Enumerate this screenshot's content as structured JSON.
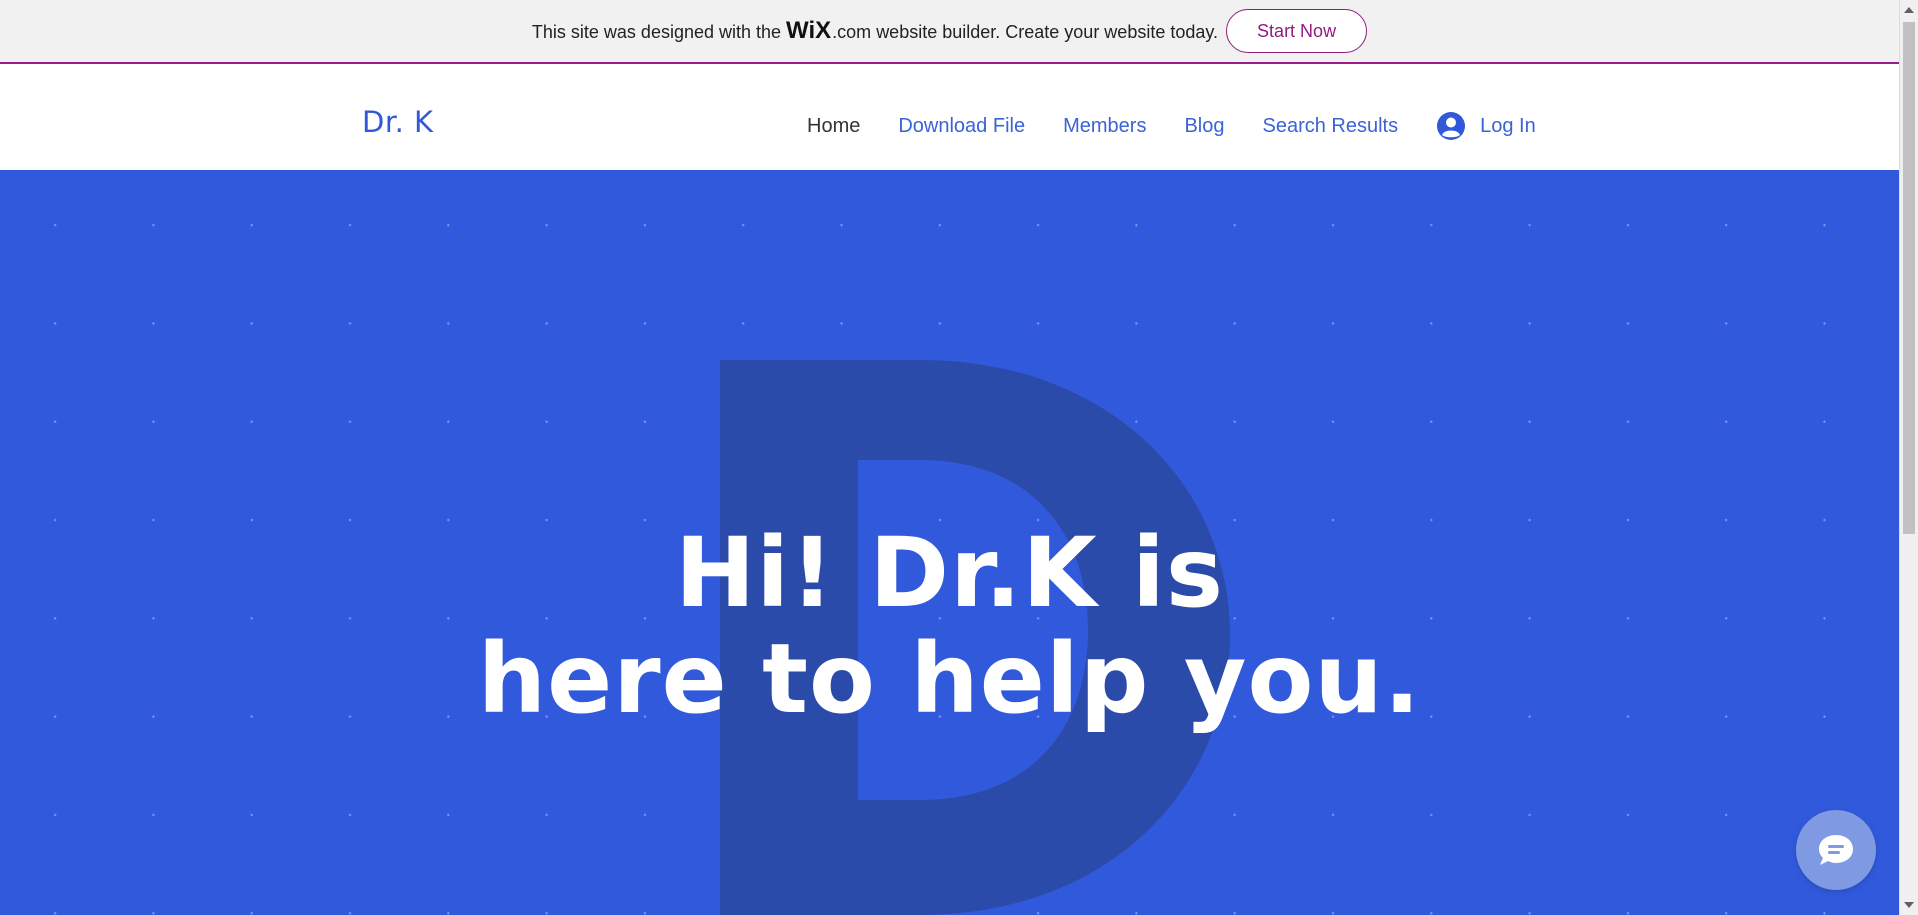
{
  "banner": {
    "text_before": "This site was designed with the",
    "wix_logo": "WiX",
    "dotcom": ".com",
    "text_after": "website builder. Create your website today.",
    "cta_label": "Start Now",
    "accent_color": "#8f1d80"
  },
  "header": {
    "brand": "Dr. K",
    "nav": [
      {
        "label": "Home",
        "active": true
      },
      {
        "label": "Download File",
        "active": false
      },
      {
        "label": "Members",
        "active": false
      },
      {
        "label": "Blog",
        "active": false
      },
      {
        "label": "Search Results",
        "active": false
      }
    ],
    "login_label": "Log In",
    "login_icon": "user-avatar-icon"
  },
  "hero": {
    "background_letter": "D",
    "headline_line1": "Hi! Dr.K is",
    "headline_line2": "here to help you.",
    "background_color": "#3159db"
  },
  "chat": {
    "icon": "chat-bubble-icon"
  }
}
